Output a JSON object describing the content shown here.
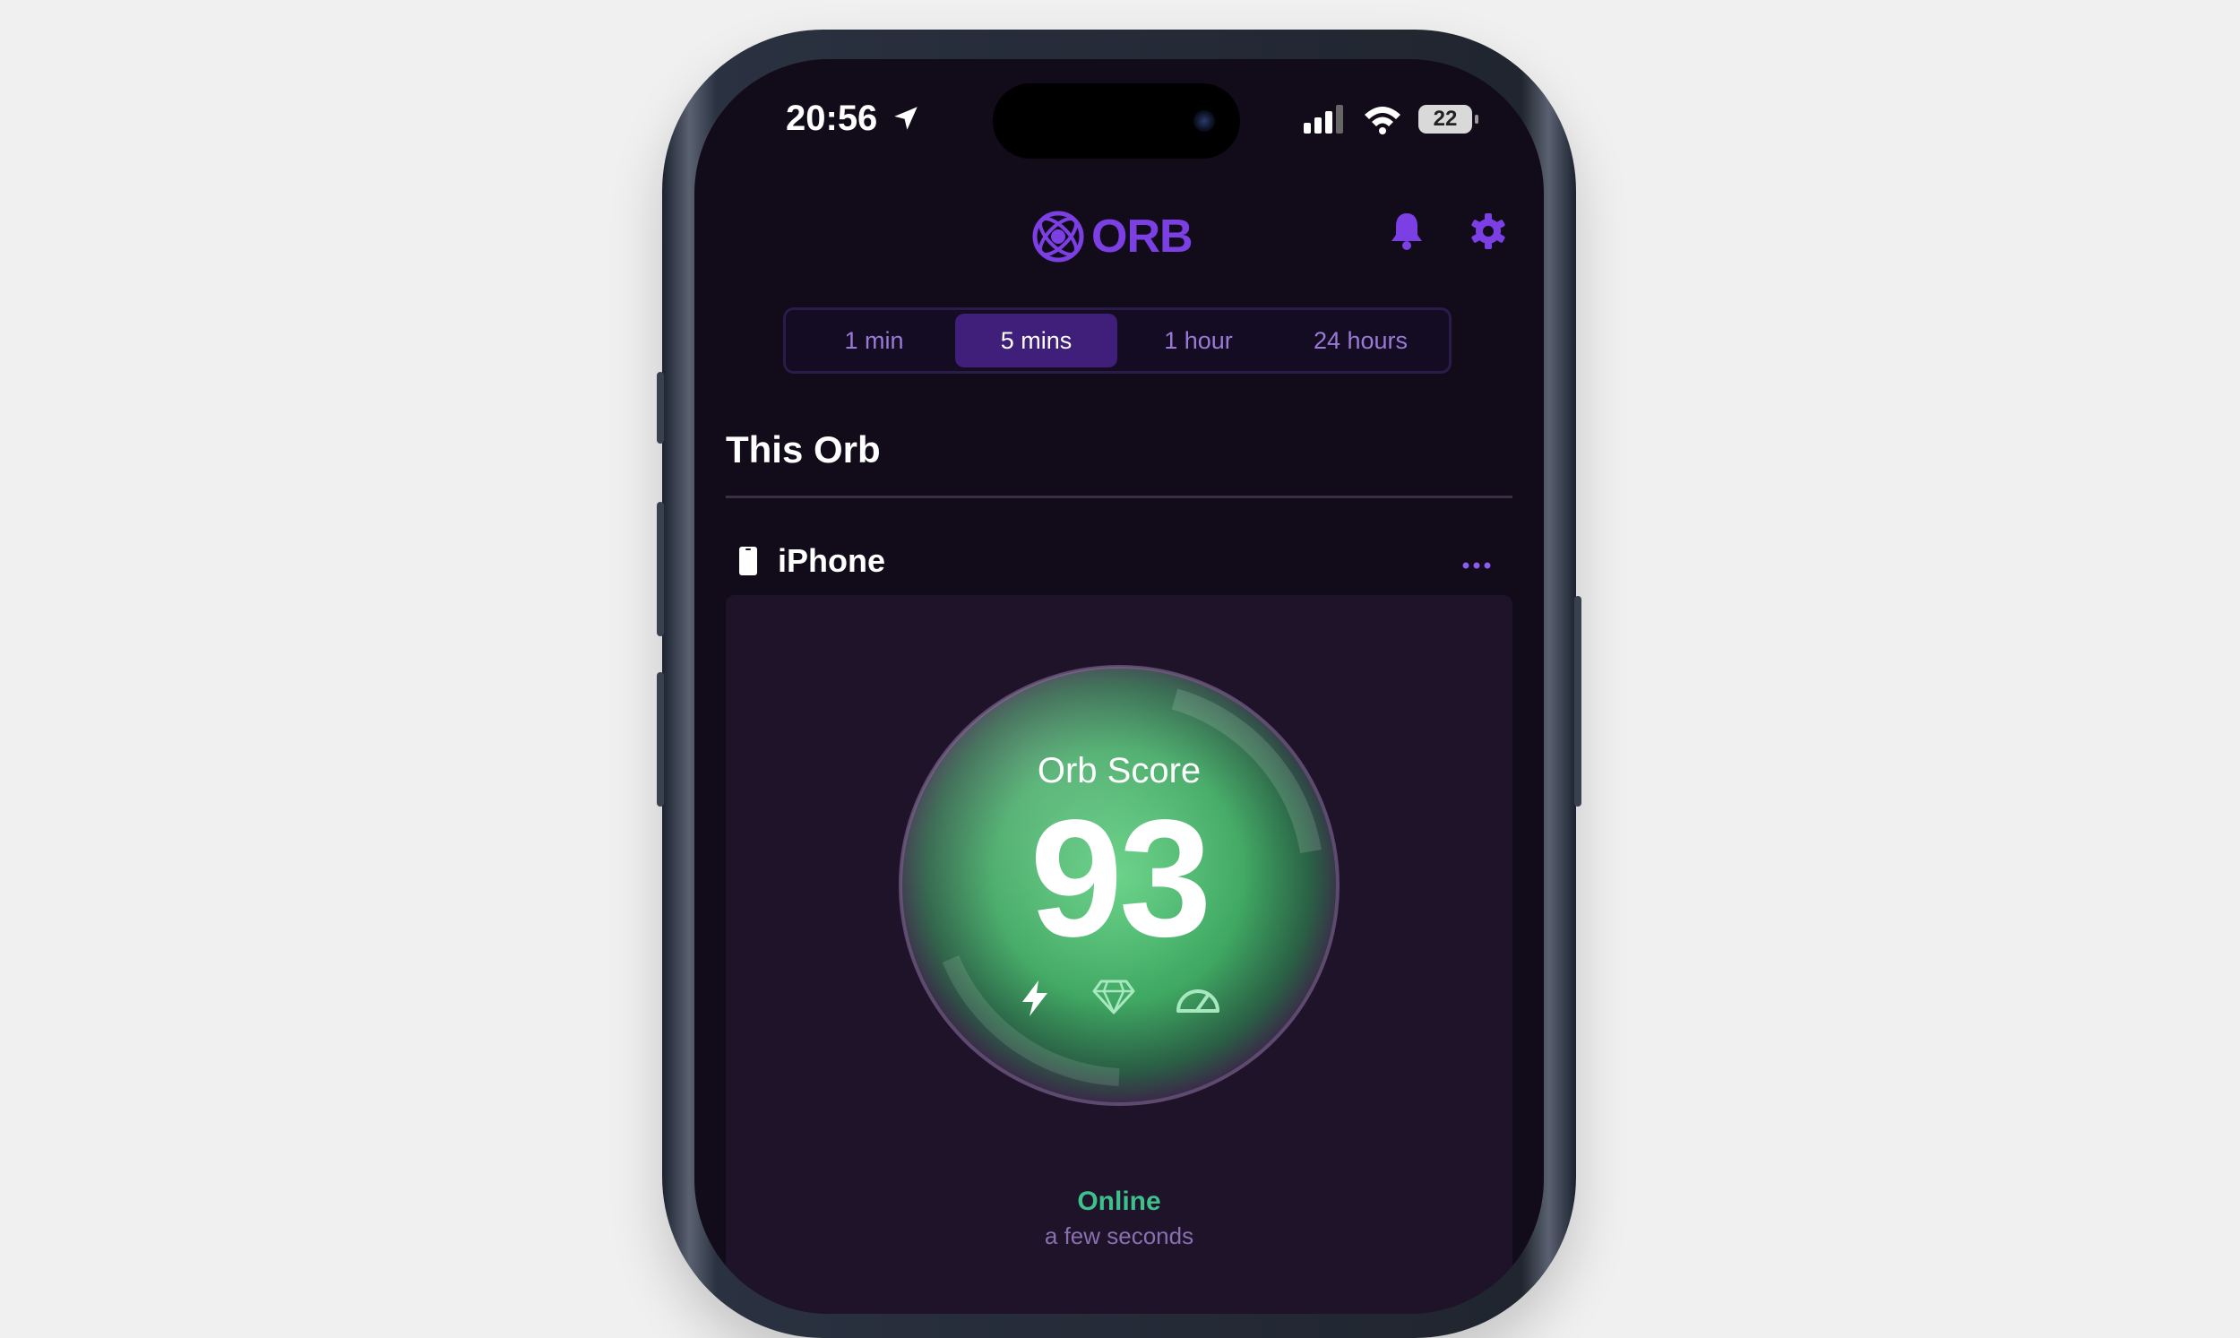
{
  "status_bar": {
    "time": "20:56",
    "battery": "22"
  },
  "header": {
    "logo_text": "ORB",
    "notifications_icon": "bell-icon",
    "settings_icon": "gear-icon"
  },
  "time_ranges": {
    "options": [
      "1 min",
      "5 mins",
      "1 hour",
      "24 hours"
    ],
    "selected": "5 mins"
  },
  "section": {
    "title": "This Orb"
  },
  "device": {
    "name": "iPhone",
    "icon": "phone-icon",
    "menu_icon": "more-icon"
  },
  "orb": {
    "label": "Orb Score",
    "score": "93",
    "metric_icons": [
      "lightning-icon",
      "diamond-icon",
      "speedometer-icon"
    ]
  },
  "connection": {
    "status": "Online",
    "updated": "a few seconds"
  },
  "colors": {
    "accent": "#7b3fe4",
    "background": "#120b1a",
    "card": "#1f1329",
    "online": "#3ec08c",
    "orb_green": "#4fbd72"
  }
}
